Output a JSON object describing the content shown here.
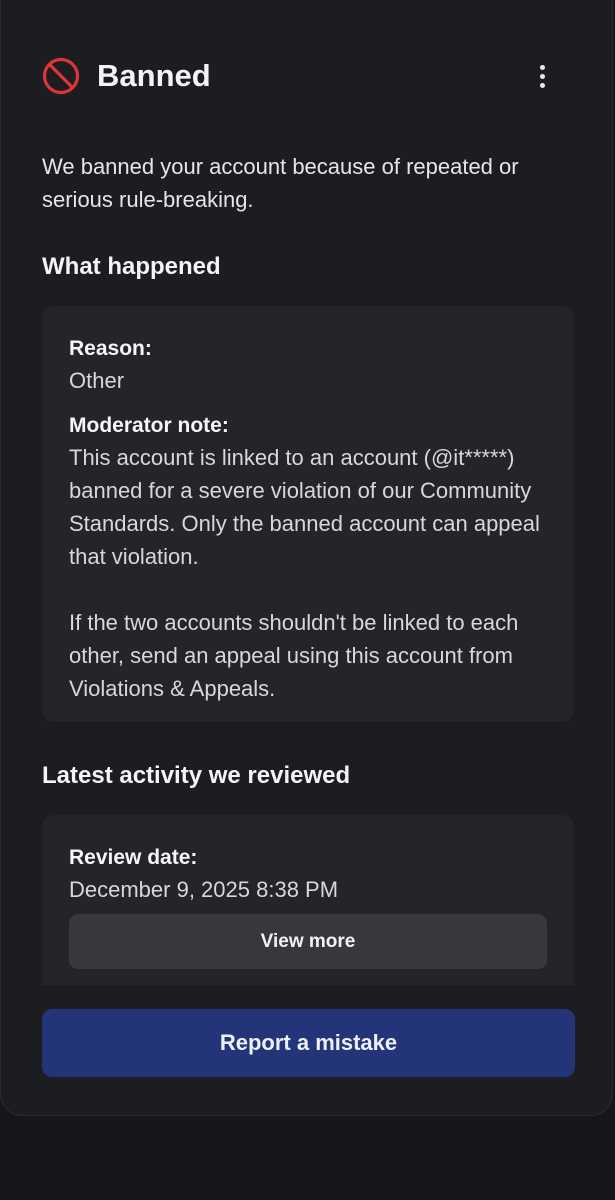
{
  "header": {
    "title": "Banned",
    "icon": "ban-icon",
    "menu_icon": "more-vertical-icon"
  },
  "intro_text": "We banned your account because of repeated or serious rule-breaking.",
  "what_happened": {
    "heading": "What happened",
    "reason_label": "Reason:",
    "reason_value": "Other",
    "note_label": "Moderator note:",
    "note_paragraphs": [
      "This account is linked to an account (@it*****) banned for a severe violation of our Community Standards. Only the banned account can appeal that violation.",
      "If the two accounts shouldn't be linked to each other, send an appeal using this account from Violations & Appeals."
    ]
  },
  "latest_activity": {
    "heading": "Latest activity we reviewed",
    "review_date_label": "Review date:",
    "review_date_value": "December 9, 2025 8:38 PM",
    "view_more_label": "View more"
  },
  "report_button_label": "Report a mistake",
  "colors": {
    "background": "#151619",
    "sheet": "#1c1d21",
    "card": "#24252b",
    "ban_red": "#e0333a",
    "primary_button": "#233479",
    "secondary_button": "#36383e"
  }
}
